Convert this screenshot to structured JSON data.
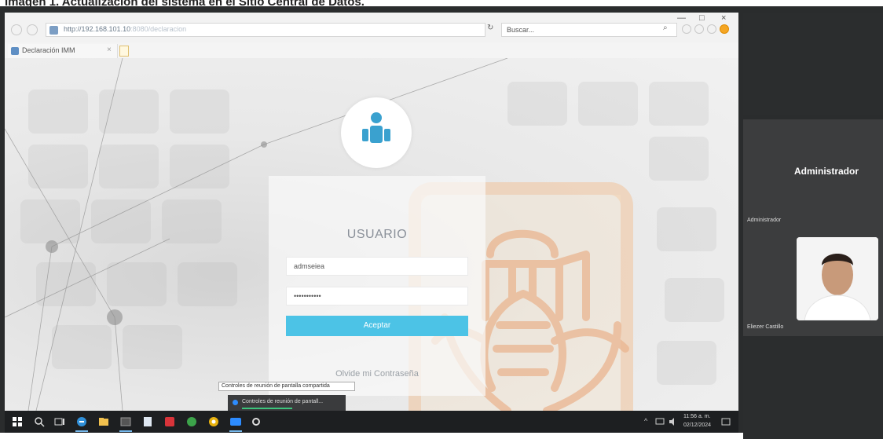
{
  "caption": "Imagen 1. Actualización del sistema en el Sitio Central de Datos.",
  "browser": {
    "url_main": "http://192.168.101.10",
    "url_rest": ":8080/declaracion",
    "search_placeholder": "Buscar...",
    "reload_glyph": "↻",
    "search_glyph": "⌕",
    "tab_label": "Declaración IMM",
    "tab_close": "×",
    "win_min": "—",
    "win_max": "□",
    "win_close": "×"
  },
  "login": {
    "heading": "USUARIO",
    "username_value": "admseiea",
    "password_value": "•••••••••••",
    "submit_label": "Aceptar",
    "forgot_link": "Olvide mi Contraseña"
  },
  "overlay": {
    "tooltip": "Controles de reunión de pantalla compartida",
    "share_controls": "Controles de reunión de pantall..."
  },
  "taskbar": {
    "time": "11:56 a. m.",
    "date": "02/12/2024",
    "chevron": "^"
  },
  "meeting_panel": {
    "host_name": "Administrador",
    "host_label": "Administrador",
    "participant_label": "Eliezer Castillo"
  },
  "colors": {
    "accent": "#4cc3e6",
    "logo_blue": "#3aa1cf",
    "panel_bg": "#3c3d3e"
  },
  "icons": [
    "user-group-icon",
    "windows-start-icon",
    "search-icon",
    "task-view-icon",
    "edge-icon",
    "file-explorer-icon",
    "chrome-icon",
    "zoom-icon",
    "settings-icon"
  ]
}
